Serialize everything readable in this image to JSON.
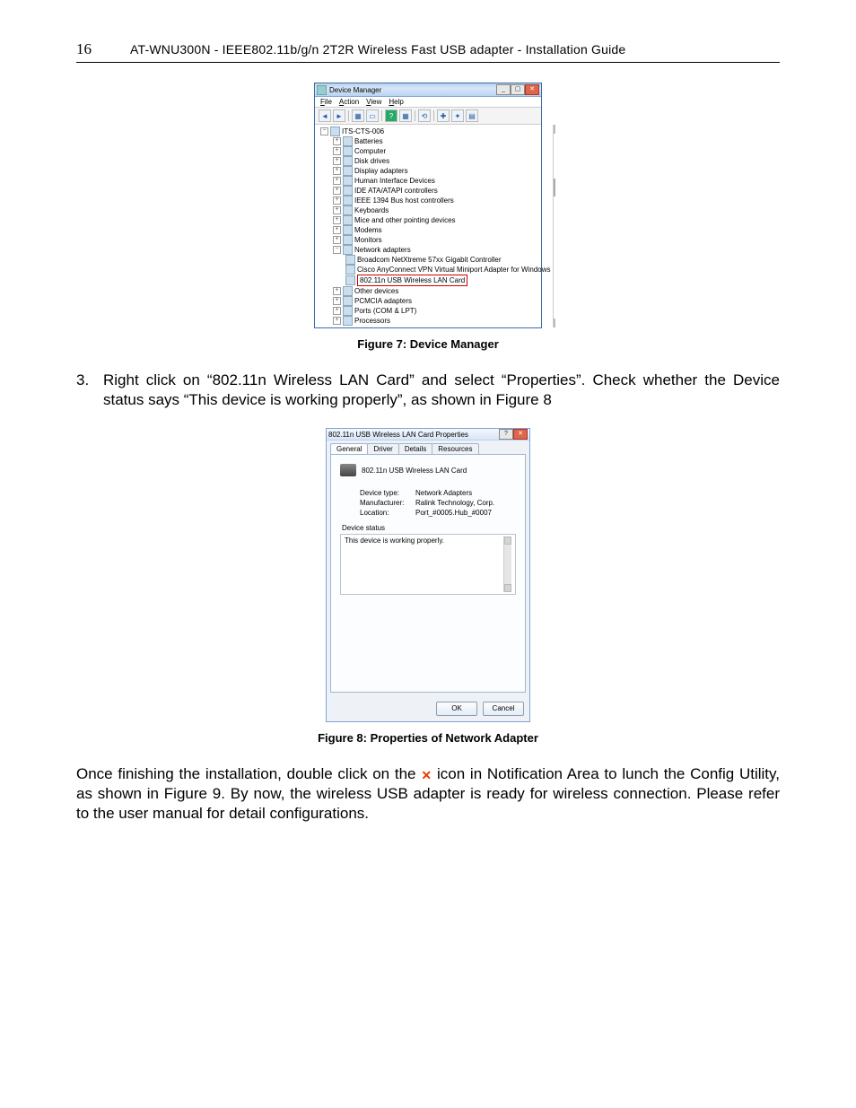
{
  "page_number": "16",
  "document_title": "AT-WNU300N - IEEE802.11b/g/n 2T2R Wireless Fast USB adapter - Installation Guide",
  "fig7": {
    "window_title": "Device Manager",
    "menu": {
      "file": "File",
      "action": "Action",
      "view": "View",
      "help": "Help"
    },
    "root": "ITS-CTS-006",
    "nodes": {
      "batteries": "Batteries",
      "computer": "Computer",
      "disk": "Disk drives",
      "display": "Display adapters",
      "hid": "Human Interface Devices",
      "ide": "IDE ATA/ATAPI controllers",
      "ieee1394": "IEEE 1394 Bus host controllers",
      "keyboards": "Keyboards",
      "mice": "Mice and other pointing devices",
      "modems": "Modems",
      "monitors": "Monitors",
      "network": "Network adapters",
      "net_broadcom": "Broadcom NetXtreme 57xx Gigabit Controller",
      "net_cisco": "Cisco AnyConnect VPN Virtual Miniport Adapter for Windows",
      "net_wlan": "802.11n USB Wireless LAN Card",
      "other": "Other devices",
      "pcmcia": "PCMCIA adapters",
      "ports": "Ports (COM & LPT)",
      "processors": "Processors"
    },
    "caption": "Figure 7: Device Manager"
  },
  "step3": {
    "num": "3.",
    "text": "Right click on “802.11n Wireless LAN Card” and select “Properties”. Check whether the Device status says “This device is working properly”, as shown in Figure 8"
  },
  "fig8": {
    "window_title": "802.11n USB Wireless LAN Card Properties",
    "tabs": {
      "general": "General",
      "driver": "Driver",
      "details": "Details",
      "resources": "Resources"
    },
    "device_name": "802.11n USB Wireless LAN Card",
    "kv": {
      "type_k": "Device type:",
      "type_v": "Network Adapters",
      "mfr_k": "Manufacturer:",
      "mfr_v": "Ralink Technology, Corp.",
      "loc_k": "Location:",
      "loc_v": "Port_#0005.Hub_#0007"
    },
    "status_label": "Device status",
    "status_text": "This device is working properly.",
    "ok": "OK",
    "cancel": "Cancel",
    "caption": "Figure 8: Properties of Network Adapter"
  },
  "closing_para_1": "Once finishing the installation, double click on the",
  "closing_icon_glyph": "✕",
  "closing_para_2": "icon in Notification Area to lunch the Config Utility, as shown in Figure 9. By now, the wireless USB adapter is ready for wireless connection. Please refer to the user manual for detail configurations."
}
